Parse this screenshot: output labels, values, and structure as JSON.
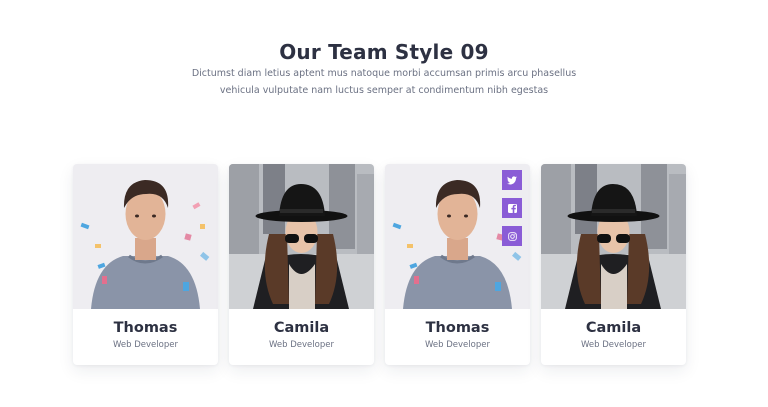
{
  "header": {
    "title": "Our Team Style 09",
    "subtitle_line1": "Dictumst diam letius aptent mus natoque morbi accumsan primis arcu phasellus",
    "subtitle_line2": "vehicula vulputate nam luctus semper at condimentum nibh egestas"
  },
  "colors": {
    "accent": "#8a5cd6",
    "heading": "#2d3142",
    "muted": "#6b7183"
  },
  "team": [
    {
      "name": "Thomas",
      "role": "Web Developer",
      "photo": "young-man-grey-sweater-confetti"
    },
    {
      "name": "Camila",
      "role": "Web Developer",
      "photo": "woman-black-hat-sunglasses-city"
    },
    {
      "name": "Thomas",
      "role": "Web Developer",
      "photo": "young-man-grey-sweater-confetti",
      "social": [
        "twitter-icon",
        "facebook-icon",
        "instagram-icon"
      ]
    },
    {
      "name": "Camila",
      "role": "Web Developer",
      "photo": "woman-black-hat-sunglasses-city"
    }
  ]
}
